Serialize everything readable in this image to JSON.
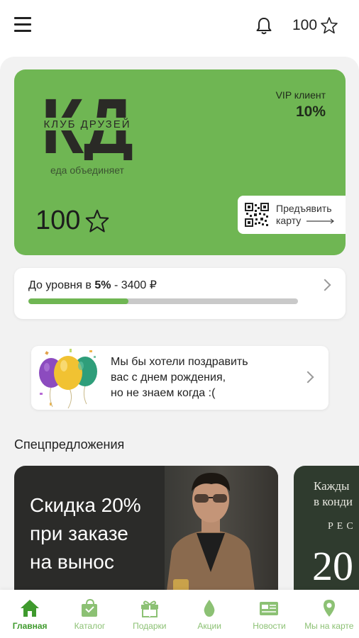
{
  "header": {
    "points": "100"
  },
  "loyalty_card": {
    "logo_letters": "КД",
    "logo_subtitle": "КЛУБ ДРУЗЕЙ",
    "tagline": "еда объединяет",
    "vip_label": "VIP клиент",
    "vip_value": "10%",
    "points": "100",
    "show_card_line1": "Предъявить",
    "show_card_line2": "карту",
    "color": "#6fb653"
  },
  "level_progress": {
    "prefix": "До уровня в ",
    "level": "5%",
    "suffix": " - 3400 ₽",
    "fraction": 0.37
  },
  "birthday": {
    "line1": "Мы бы хотели поздравить",
    "line2": "вас с днем рождения,",
    "line3": "но не знаем когда :("
  },
  "specials": {
    "title": "Спецпредложения",
    "promo1": {
      "line1": "Скидка 20%",
      "line2": "при заказе",
      "line3": "на вынос"
    },
    "promo2": {
      "line1": "Кажды",
      "line2": "в конди",
      "brand": "РЕС",
      "big": "20"
    }
  },
  "nav": {
    "items": [
      {
        "label": "Главная",
        "icon": "home-icon",
        "active": true
      },
      {
        "label": "Каталог",
        "icon": "catalog-bag-icon",
        "active": false
      },
      {
        "label": "Подарки",
        "icon": "gift-icon",
        "active": false
      },
      {
        "label": "Акции",
        "icon": "flame-drop-icon",
        "active": false
      },
      {
        "label": "Новости",
        "icon": "news-icon",
        "active": false
      },
      {
        "label": "Мы на карте",
        "icon": "map-pin-icon",
        "active": false
      }
    ]
  }
}
